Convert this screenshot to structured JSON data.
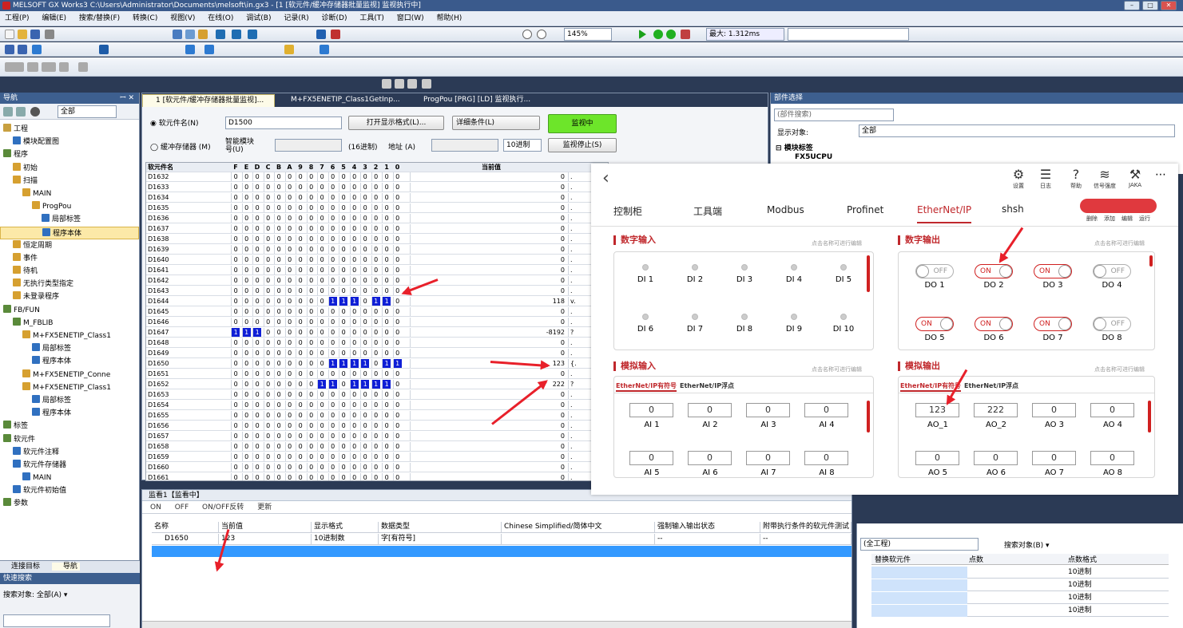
{
  "window": {
    "title": "MELSOFT GX Works3 C:\\Users\\Administrator\\Documents\\melsoft\\in.gx3 - [1 [软元件/缓冲存储器批量监视] 监视执行中]"
  },
  "menu": [
    "工程(P)",
    "编辑(E)",
    "搜索/替换(F)",
    "转换(C)",
    "视图(V)",
    "在线(O)",
    "调试(B)",
    "记录(R)",
    "诊断(D)",
    "工具(T)",
    "窗口(W)",
    "帮助(H)"
  ],
  "toolbar": {
    "zoom": "145%",
    "scan_time": "最大: 1.312ms"
  },
  "nav": {
    "title": "导航",
    "filter": "全部",
    "items": [
      {
        "label": "工程",
        "level": 0,
        "color": "#c8a040"
      },
      {
        "label": "模块配置图",
        "level": 1,
        "color": "#3070c0"
      },
      {
        "label": "程序",
        "level": 0,
        "color": "#5a8a3a"
      },
      {
        "label": "初始",
        "level": 1,
        "color": "#d6a030"
      },
      {
        "label": "扫描",
        "level": 1,
        "color": "#d6a030"
      },
      {
        "label": "MAIN",
        "level": 2,
        "color": "#d6a030"
      },
      {
        "label": "ProgPou",
        "level": 3,
        "color": "#d6a030"
      },
      {
        "label": "局部标签",
        "level": 4,
        "color": "#3070c0"
      },
      {
        "label": "程序本体",
        "level": 4,
        "color": "#3070c0",
        "selected": true
      },
      {
        "label": "恒定周期",
        "level": 1,
        "color": "#d6a030"
      },
      {
        "label": "事件",
        "level": 1,
        "color": "#d6a030"
      },
      {
        "label": "待机",
        "level": 1,
        "color": "#d6a030"
      },
      {
        "label": "无执行类型指定",
        "level": 1,
        "color": "#d6a030"
      },
      {
        "label": "未登录程序",
        "level": 1,
        "color": "#d6a030"
      },
      {
        "label": "FB/FUN",
        "level": 0,
        "color": "#5a8a3a"
      },
      {
        "label": "M_FBLIB",
        "level": 1,
        "color": "#5a8a3a"
      },
      {
        "label": "M+FX5ENETIP_Class1",
        "level": 2,
        "color": "#d6a030"
      },
      {
        "label": "局部标签",
        "level": 3,
        "color": "#3070c0"
      },
      {
        "label": "程序本体",
        "level": 3,
        "color": "#3070c0"
      },
      {
        "label": "M+FX5ENETIP_Conne",
        "level": 2,
        "color": "#d6a030"
      },
      {
        "label": "M+FX5ENETIP_Class1",
        "level": 2,
        "color": "#d6a030"
      },
      {
        "label": "局部标签",
        "level": 3,
        "color": "#3070c0"
      },
      {
        "label": "程序本体",
        "level": 3,
        "color": "#3070c0"
      },
      {
        "label": "标签",
        "level": 0,
        "color": "#5a8a3a"
      },
      {
        "label": "软元件",
        "level": 0,
        "color": "#5a8a3a"
      },
      {
        "label": "软元件注释",
        "level": 1,
        "color": "#3070c0"
      },
      {
        "label": "软元件存储器",
        "level": 1,
        "color": "#3070c0"
      },
      {
        "label": "MAIN",
        "level": 2,
        "color": "#3070c0"
      },
      {
        "label": "软元件初始值",
        "level": 1,
        "color": "#3070c0"
      },
      {
        "label": "参数",
        "level": 0,
        "color": "#5a8a3a"
      }
    ],
    "bottom_tabs": [
      "连接目标",
      "导航"
    ]
  },
  "quick_search": {
    "title": "快速搜索",
    "scope": "搜索对象: 全部(A) ▾"
  },
  "doc_tabs": [
    "1 [软元件/缓冲存储器批量监视]...",
    "M+FX5ENETIP_Class1GetInp...",
    "ProgPou [PRG] [LD] 监视执行..."
  ],
  "monitor": {
    "radio_device": "软元件名(N)",
    "device_value": "D1500",
    "radio_buffer": "缓冲存储器 (M)",
    "smart_module": "智能模块号(U)",
    "hex_unit": "(16进制)",
    "address": "地址 (A)",
    "radix": "10进制",
    "btn_format": "打开显示格式(L)...",
    "btn_detail": "详细条件(L)",
    "btn_monitoring": "监视中",
    "btn_stop": "监视停止(S)"
  },
  "grid": {
    "headers": [
      "软元件名",
      "F",
      "E",
      "D",
      "C",
      "B",
      "A",
      "9",
      "8",
      "7",
      "6",
      "5",
      "4",
      "3",
      "2",
      "1",
      "0",
      "当前值"
    ],
    "rows": [
      {
        "name": "D1632",
        "bits": "0000000000000000",
        "val": "0",
        "ch": "."
      },
      {
        "name": "D1633",
        "bits": "0000000000000000",
        "val": "0",
        "ch": "."
      },
      {
        "name": "D1634",
        "bits": "0000000000000000",
        "val": "0",
        "ch": "."
      },
      {
        "name": "D1635",
        "bits": "0000000000000000",
        "val": "0",
        "ch": "."
      },
      {
        "name": "D1636",
        "bits": "0000000000000000",
        "val": "0",
        "ch": "."
      },
      {
        "name": "D1637",
        "bits": "0000000000000000",
        "val": "0",
        "ch": "."
      },
      {
        "name": "D1638",
        "bits": "0000000000000000",
        "val": "0",
        "ch": "."
      },
      {
        "name": "D1639",
        "bits": "0000000000000000",
        "val": "0",
        "ch": "."
      },
      {
        "name": "D1640",
        "bits": "0000000000000000",
        "val": "0",
        "ch": "."
      },
      {
        "name": "D1641",
        "bits": "0000000000000000",
        "val": "0",
        "ch": "."
      },
      {
        "name": "D1642",
        "bits": "0000000000000000",
        "val": "0",
        "ch": "."
      },
      {
        "name": "D1643",
        "bits": "0000000000000000",
        "val": "0",
        "ch": "."
      },
      {
        "name": "D1644",
        "bits": "0000000001110110",
        "val": "118",
        "ch": "v."
      },
      {
        "name": "D1645",
        "bits": "0000000000000000",
        "val": "0",
        "ch": "."
      },
      {
        "name": "D1646",
        "bits": "0000000000000000",
        "val": "0",
        "ch": "."
      },
      {
        "name": "D1647",
        "bits": "1110000000000000",
        "val": "-8192",
        "ch": "?"
      },
      {
        "name": "D1648",
        "bits": "0000000000000000",
        "val": "0",
        "ch": "."
      },
      {
        "name": "D1649",
        "bits": "0000000000000000",
        "val": "0",
        "ch": "."
      },
      {
        "name": "D1650",
        "bits": "0000000001111011",
        "val": "123",
        "ch": "{."
      },
      {
        "name": "D1651",
        "bits": "0000000000000000",
        "val": "0",
        "ch": "."
      },
      {
        "name": "D1652",
        "bits": "0000000011011110",
        "val": "222",
        "ch": "?"
      },
      {
        "name": "D1653",
        "bits": "0000000000000000",
        "val": "0",
        "ch": "."
      },
      {
        "name": "D1654",
        "bits": "0000000000000000",
        "val": "0",
        "ch": "."
      },
      {
        "name": "D1655",
        "bits": "0000000000000000",
        "val": "0",
        "ch": "."
      },
      {
        "name": "D1656",
        "bits": "0000000000000000",
        "val": "0",
        "ch": "."
      },
      {
        "name": "D1657",
        "bits": "0000000000000000",
        "val": "0",
        "ch": "."
      },
      {
        "name": "D1658",
        "bits": "0000000000000000",
        "val": "0",
        "ch": "."
      },
      {
        "name": "D1659",
        "bits": "0000000000000000",
        "val": "0",
        "ch": "."
      },
      {
        "name": "D1660",
        "bits": "0000000000000000",
        "val": "0",
        "ch": "."
      },
      {
        "name": "D1661",
        "bits": "0000000000000000",
        "val": "0",
        "ch": "."
      }
    ]
  },
  "watch": {
    "title": "监看1【监看中】",
    "tools": [
      "ON",
      "OFF",
      "ON/OFF反转",
      "更新"
    ],
    "headers": [
      "名称",
      "当前值",
      "显示格式",
      "数据类型",
      "Chinese Simplified/简体中文",
      "强制输入输出状态",
      "附带执行条件的软元件测试"
    ],
    "row": {
      "name": "D1650",
      "value": "123",
      "format": "10进制数",
      "type": "字[有符号]",
      "comment": "",
      "force": "--",
      "cond": "--"
    }
  },
  "parts": {
    "title": "部件选择",
    "search_placeholder": "(部件搜索)",
    "display_label": "显示对象:",
    "display_value": "全部",
    "cat": "模块标签",
    "item": "FX5UCPU"
  },
  "replace": {
    "scope": "(全工程)",
    "target": "搜索对象(B) ▾",
    "headers": [
      "替换软元件",
      "点数",
      "点数格式"
    ],
    "radix_rows": [
      "10进制",
      "10进制",
      "10进制",
      "10进制"
    ]
  },
  "hmi": {
    "top_icons": [
      "设置",
      "日志",
      "帮助",
      "信号强度",
      "JAKA"
    ],
    "tabs": [
      "控制柜",
      "工具端",
      "Modbus",
      "Profinet",
      "EtherNet/IP",
      "shsh"
    ],
    "tab_actions": [
      "删除",
      "添加",
      "编辑",
      "运行"
    ],
    "di_title": "数字输入",
    "do_title": "数字输出",
    "ai_title": "模拟输入",
    "ao_title": "模拟输出",
    "hint": "点击名称可进行编辑",
    "di": [
      "DI 1",
      "DI 2",
      "DI 3",
      "DI 4",
      "DI 5",
      "DI 6",
      "DI 7",
      "DI 8",
      "DI 9",
      "DI 10"
    ],
    "do": [
      {
        "label": "DO 1",
        "state": "OFF"
      },
      {
        "label": "DO 2",
        "state": "ON"
      },
      {
        "label": "DO 3",
        "state": "ON"
      },
      {
        "label": "DO 4",
        "state": "OFF"
      },
      {
        "label": "DO 5",
        "state": "ON"
      },
      {
        "label": "DO 6",
        "state": "ON"
      },
      {
        "label": "DO 7",
        "state": "ON"
      },
      {
        "label": "DO 8",
        "state": "OFF"
      }
    ],
    "ai_tabs": [
      "EtherNet/IP有符号",
      "EtherNet/IP浮点"
    ],
    "ao_tabs": [
      "EtherNet/IP有符号",
      "EtherNet/IP浮点"
    ],
    "ai": [
      {
        "label": "AI 1",
        "value": "0"
      },
      {
        "label": "AI 2",
        "value": "0"
      },
      {
        "label": "AI 3",
        "value": "0"
      },
      {
        "label": "AI 4",
        "value": "0"
      },
      {
        "label": "AI 5",
        "value": "0"
      },
      {
        "label": "AI 6",
        "value": "0"
      },
      {
        "label": "AI 7",
        "value": "0"
      },
      {
        "label": "AI 8",
        "value": "0"
      }
    ],
    "ao": [
      {
        "label": "AO_1",
        "value": "123"
      },
      {
        "label": "AO_2",
        "value": "222"
      },
      {
        "label": "AO 3",
        "value": "0"
      },
      {
        "label": "AO 4",
        "value": "0"
      },
      {
        "label": "AO 5",
        "value": "0"
      },
      {
        "label": "AO 6",
        "value": "0"
      },
      {
        "label": "AO 7",
        "value": "0"
      },
      {
        "label": "AO 8",
        "value": "0"
      }
    ]
  },
  "colors": {
    "accent_red": "#d02020",
    "bit_on": "#0f1fd6",
    "monitor_green": "#6de52a",
    "title_blue": "#3a5a8c"
  }
}
